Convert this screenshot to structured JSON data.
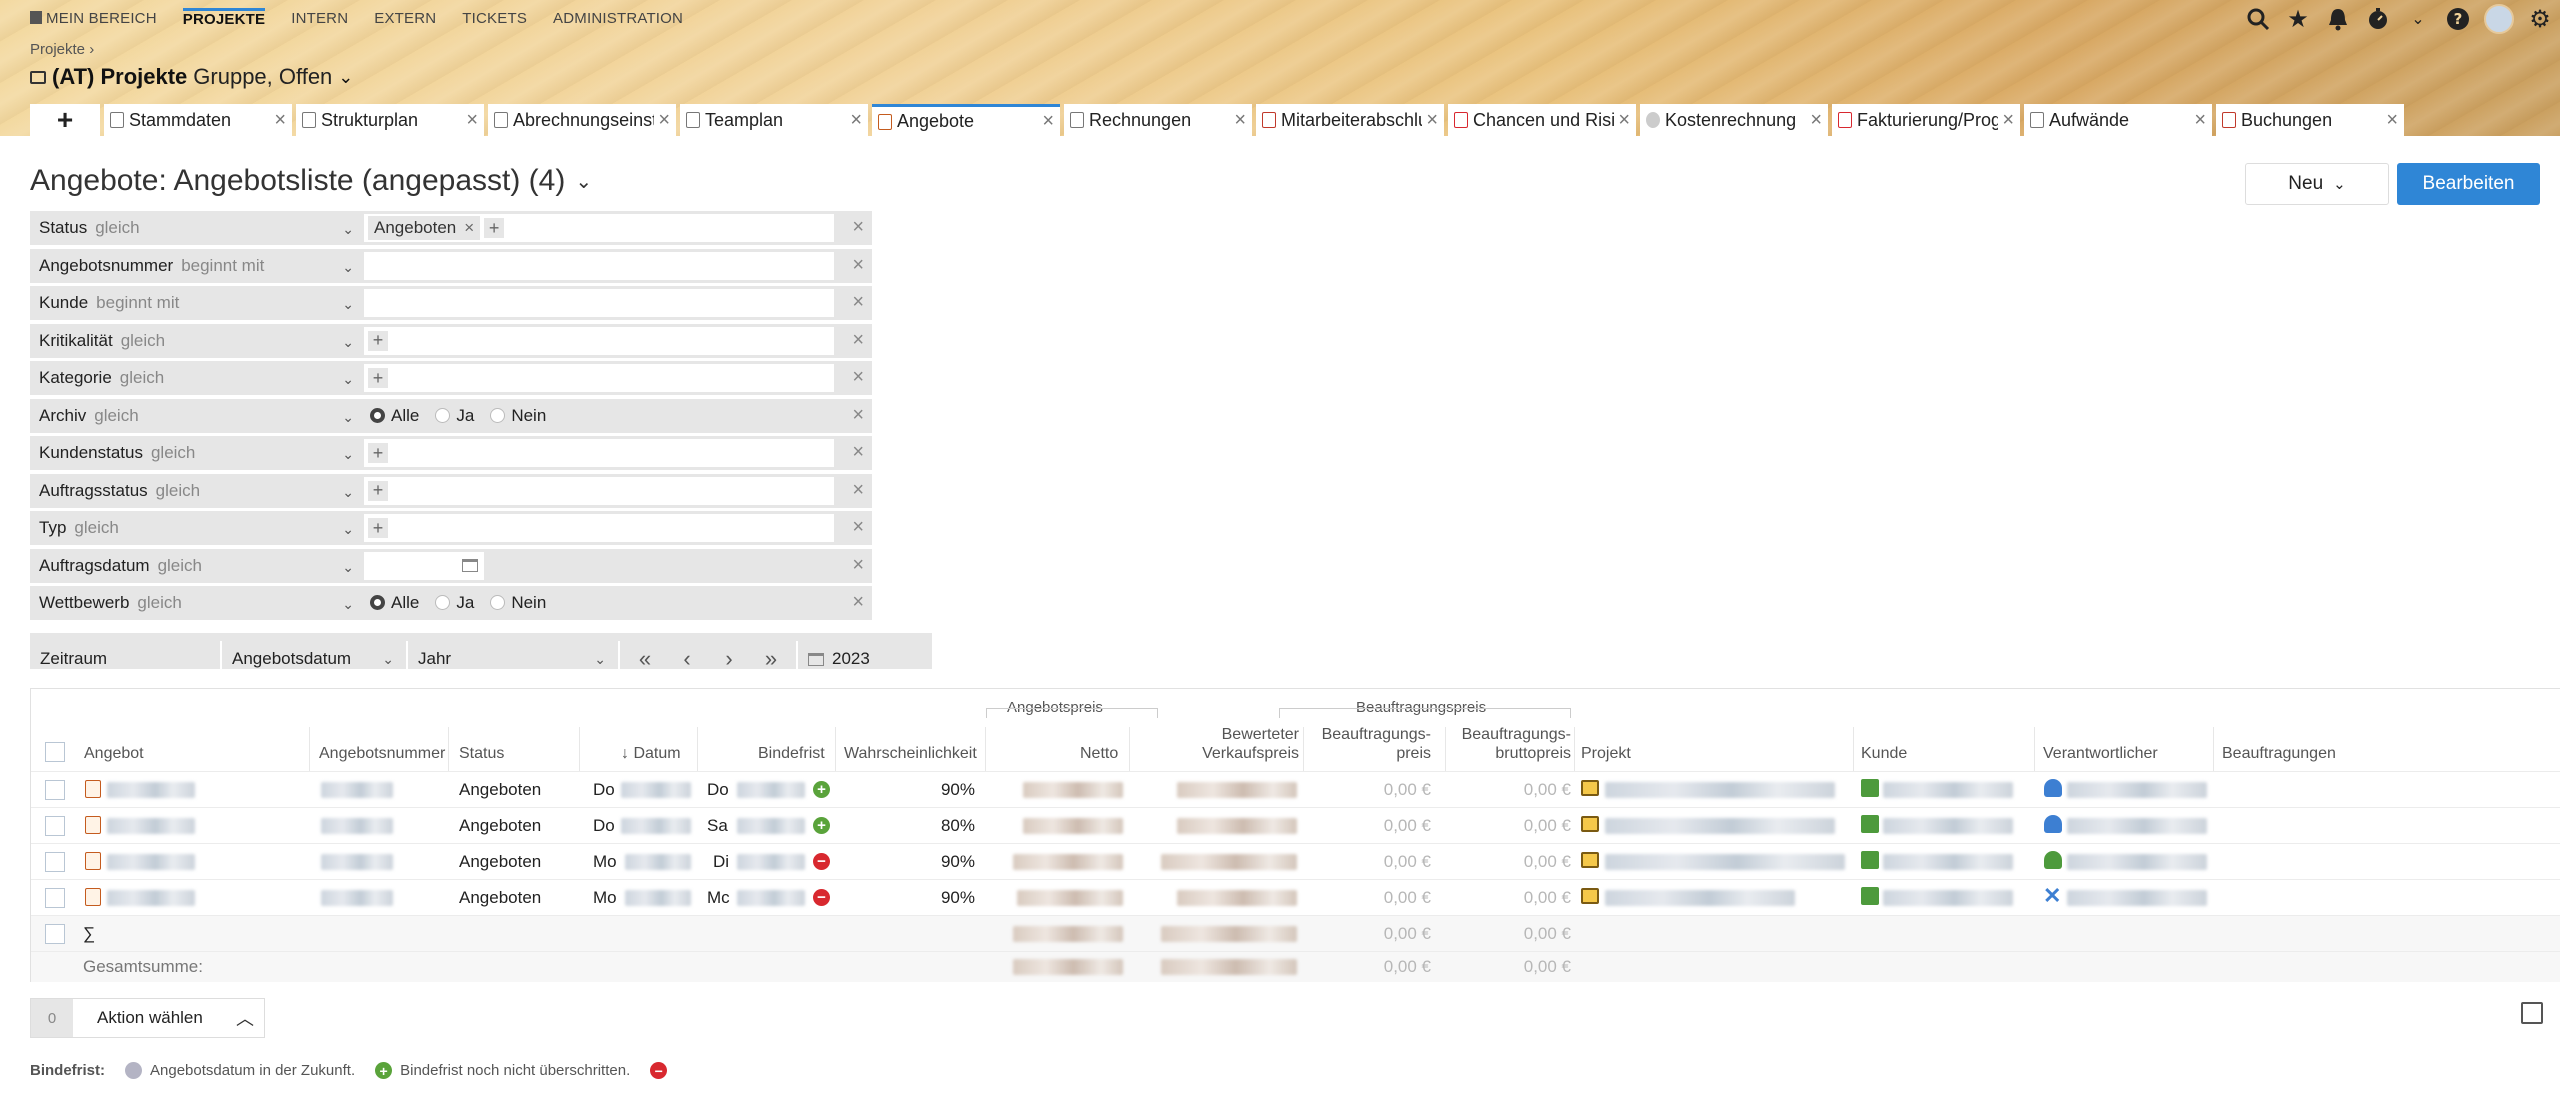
{
  "topnav": {
    "items": [
      {
        "label": "MEIN BEREICH",
        "active": false
      },
      {
        "label": "PROJEKTE",
        "active": true
      },
      {
        "label": "INTERN",
        "active": false
      },
      {
        "label": "EXTERN",
        "active": false
      },
      {
        "label": "TICKETS",
        "active": false
      },
      {
        "label": "ADMINISTRATION",
        "active": false
      }
    ]
  },
  "breadcrumb": "Projekte ›",
  "project": {
    "name": "(AT) Projekte",
    "subtitle": "Gruppe, Offen"
  },
  "tabs": [
    {
      "label": "Stammdaten",
      "active": false
    },
    {
      "label": "Strukturplan",
      "active": false
    },
    {
      "label": "Abrechnungseinstellungen",
      "active": false
    },
    {
      "label": "Teamplan",
      "active": false
    },
    {
      "label": "Angebote",
      "active": true
    },
    {
      "label": "Rechnungen",
      "active": false
    },
    {
      "label": "Mitarbeiterabschluss",
      "active": false
    },
    {
      "label": "Chancen und Risiken",
      "active": false
    },
    {
      "label": "Kostenrechnung",
      "active": false
    },
    {
      "label": "Fakturierung/Prognose",
      "active": false
    },
    {
      "label": "Aufwände",
      "active": false
    },
    {
      "label": "Buchungen",
      "active": false
    }
  ],
  "page": {
    "title": "Angebote: Angebotsliste (angepasst) (4)",
    "new_label": "Neu",
    "edit_label": "Bearbeiten"
  },
  "filters": [
    {
      "name": "Status",
      "op": "gleich",
      "chip": "Angeboten"
    },
    {
      "name": "Angebotsnummer",
      "op": "beginnt mit"
    },
    {
      "name": "Kunde",
      "op": "beginnt mit"
    },
    {
      "name": "Kritikalität",
      "op": "gleich"
    },
    {
      "name": "Kategorie",
      "op": "gleich"
    },
    {
      "name": "Archiv",
      "op": "gleich"
    },
    {
      "name": "Kundenstatus",
      "op": "gleich"
    },
    {
      "name": "Auftragsstatus",
      "op": "gleich"
    },
    {
      "name": "Typ",
      "op": "gleich"
    },
    {
      "name": "Auftragsdatum",
      "op": "gleich"
    },
    {
      "name": "Wettbewerb",
      "op": "gleich"
    }
  ],
  "radio": {
    "all": "Alle",
    "yes": "Ja",
    "no": "Nein"
  },
  "period": {
    "label": "Zeitraum",
    "field": "Angebotsdatum",
    "unit": "Jahr",
    "year": "2023"
  },
  "table": {
    "group_offer_price": "Angebotspreis",
    "group_order_price": "Beauftragungspreis",
    "headers": {
      "offer": "Angebot",
      "number": "Angebotsnummer",
      "status": "Status",
      "date": "Datum",
      "deadline": "Bindefrist",
      "probability": "Wahrscheinlichkeit",
      "net_l1": "",
      "net": "Netto",
      "weighted_l1": "Bewerteter",
      "weighted_l2": "Verkaufspreis",
      "order_price_l1": "Beauftragungs-",
      "order_price_l2": "preis",
      "order_gross_l1": "Beauftragungs-",
      "order_gross_l2": "bruttopreis",
      "project": "Projekt",
      "customer": "Kunde",
      "responsible": "Verantwortlicher",
      "orders": "Beauftragungen"
    },
    "rows": [
      {
        "status": "Angeboten",
        "date_day": "Do",
        "deadline_day": "Do",
        "probability": "90%",
        "order_price": "0,00 €",
        "order_gross": "0,00 €"
      },
      {
        "status": "Angeboten",
        "date_day": "Do",
        "deadline_day": "Sa",
        "probability": "80%",
        "order_price": "0,00 €",
        "order_gross": "0,00 €"
      },
      {
        "status": "Angeboten",
        "date_day": "Mo",
        "deadline_day": "Di",
        "probability": "90%",
        "order_price": "0,00 €",
        "order_gross": "0,00 €"
      },
      {
        "status": "Angeboten",
        "date_day": "Mo",
        "deadline_day": "Mc",
        "probability": "90%",
        "order_price": "0,00 €",
        "order_gross": "0,00 €"
      }
    ],
    "sum_symbol": "∑",
    "sum_order_price": "0,00 €",
    "sum_order_gross": "0,00 €",
    "total_label": "Gesamtsumme:",
    "total_order_price": "0,00 €",
    "total_order_gross": "0,00 €"
  },
  "action": {
    "count": "0",
    "label": "Aktion wählen"
  },
  "legend": {
    "title": "Bindefrist:",
    "gray": "Angebotsdatum in der Zukunft.",
    "green": "Bindefrist noch nicht überschritten."
  },
  "colors": {
    "accent": "#2f86d6",
    "ok": "#5aa33b",
    "error": "#d8282f"
  }
}
